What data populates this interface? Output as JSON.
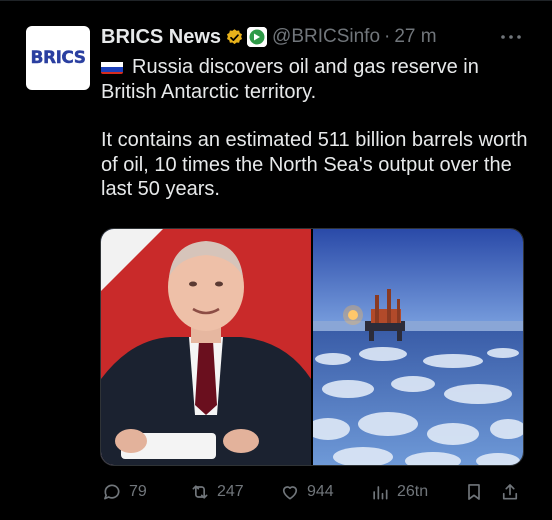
{
  "author": {
    "avatar_text": "BRICS",
    "name": "BRICS News",
    "handle": "@BRICSinfo",
    "separator": "·",
    "time": "27 m"
  },
  "post": {
    "paragraph_1": "Russia discovers oil and gas reserve in British Antarctic territory.",
    "paragraph_2": "It contains an estimated 511 billion barrels worth of oil, 10 times the North Sea's output over the last 50 years."
  },
  "actions": {
    "replies": "79",
    "reposts": "247",
    "likes": "944",
    "views": "26tn"
  },
  "colors": {
    "background": "#000000",
    "text": "#e7e9ea",
    "muted": "#71767b",
    "verified_gold": "#e8b21b"
  },
  "icons": [
    "more-icon",
    "reply-icon",
    "repost-icon",
    "like-icon",
    "views-icon",
    "bookmark-icon",
    "share-icon",
    "verified-badge-icon",
    "affiliate-badge-icon",
    "russia-flag-icon"
  ]
}
